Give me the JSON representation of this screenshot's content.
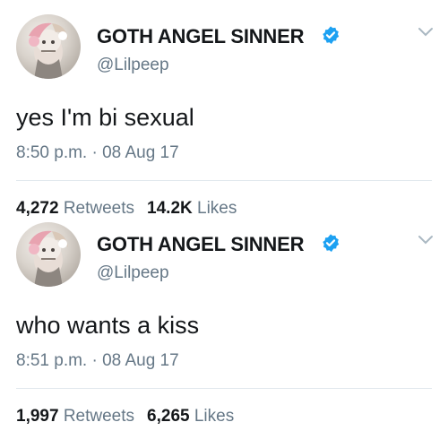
{
  "tweets": [
    {
      "display_name": "GOTH ANGEL SINNER",
      "handle": "@Lilpeep",
      "text": "yes I'm bi sexual",
      "time": "8:50 p.m.",
      "date": "08 Aug 17",
      "retweets_count": "4,272",
      "retweets_label": "Retweets",
      "likes_count": "14.2K",
      "likes_label": "Likes"
    },
    {
      "display_name": "GOTH ANGEL SINNER",
      "handle": "@Lilpeep",
      "text": "who wants a kiss",
      "time": "8:51 p.m.",
      "date": "08 Aug 17",
      "retweets_count": "1,997",
      "retweets_label": "Retweets",
      "likes_count": "6,265",
      "likes_label": "Likes"
    }
  ],
  "separator": " · ",
  "colors": {
    "verified_badge": "#1da1f2",
    "secondary_text": "#657786",
    "primary_text": "#14171a",
    "divider": "#e1e8ed"
  },
  "icons": {
    "verified": "verified-badge-icon",
    "menu": "chevron-down-icon"
  }
}
